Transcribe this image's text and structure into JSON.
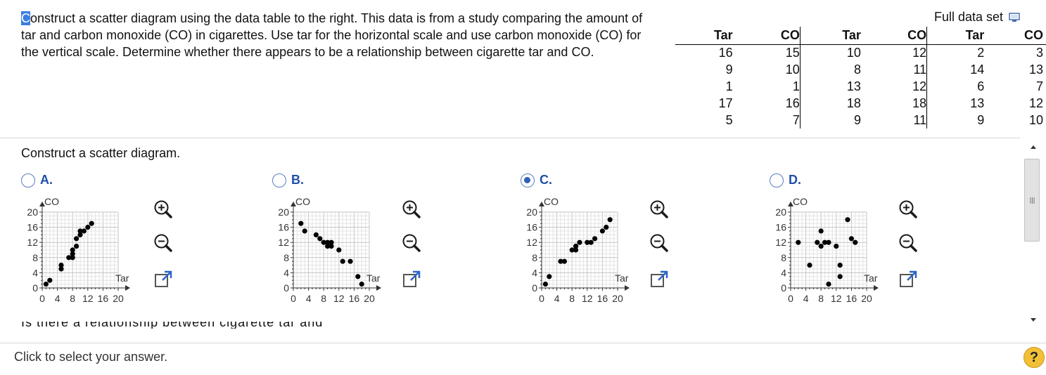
{
  "question": {
    "first_letter": "C",
    "text_rest": "onstruct a scatter diagram using the data table to the right. This data is from a study comparing the amount of tar and carbon monoxide (CO) in cigarettes. Use tar for the horizontal scale and use carbon monoxide (CO) for the vertical scale. Determine whether there appears to be a relationship between cigarette tar and CO."
  },
  "full_data_set": {
    "label": "Full data set",
    "icon": "print-icon"
  },
  "data_table": {
    "headers": [
      "Tar",
      "CO",
      "Tar",
      "CO",
      "Tar",
      "CO"
    ],
    "rows": [
      [
        "16",
        "15",
        "10",
        "12",
        "2",
        "3"
      ],
      [
        "9",
        "10",
        "8",
        "11",
        "14",
        "13"
      ],
      [
        "1",
        "1",
        "13",
        "12",
        "6",
        "7"
      ],
      [
        "17",
        "16",
        "18",
        "18",
        "13",
        "12"
      ],
      [
        "5",
        "7",
        "9",
        "11",
        "9",
        "10"
      ]
    ]
  },
  "subprompt": "Construct a scatter diagram.",
  "axes": {
    "y_label": "CO",
    "x_label": "Tar",
    "y_ticks": [
      "20",
      "16",
      "12",
      "8",
      "4",
      "0"
    ],
    "x_ticks": [
      "0",
      "4",
      "8",
      "12",
      "16",
      "20"
    ]
  },
  "options": [
    {
      "letter": "A.",
      "selected": false,
      "chart_data": {
        "type": "scatter",
        "xlabel": "Tar",
        "ylabel": "CO",
        "xlim": [
          0,
          20
        ],
        "ylim": [
          0,
          20
        ],
        "points": [
          [
            1,
            1
          ],
          [
            2,
            2
          ],
          [
            5,
            5
          ],
          [
            5,
            6
          ],
          [
            7,
            8
          ],
          [
            8,
            8
          ],
          [
            8,
            9
          ],
          [
            8,
            10
          ],
          [
            9,
            11
          ],
          [
            9,
            13
          ],
          [
            10,
            14
          ],
          [
            10,
            15
          ],
          [
            11,
            15
          ],
          [
            12,
            16
          ],
          [
            13,
            17
          ]
        ]
      }
    },
    {
      "letter": "B.",
      "selected": false,
      "chart_data": {
        "type": "scatter",
        "xlabel": "Tar",
        "ylabel": "CO",
        "xlim": [
          0,
          20
        ],
        "ylim": [
          0,
          20
        ],
        "points": [
          [
            2,
            17
          ],
          [
            3,
            15
          ],
          [
            6,
            14
          ],
          [
            7,
            13
          ],
          [
            8,
            12
          ],
          [
            9,
            12
          ],
          [
            9,
            11
          ],
          [
            10,
            12
          ],
          [
            10,
            11
          ],
          [
            12,
            10
          ],
          [
            13,
            7
          ],
          [
            15,
            7
          ],
          [
            17,
            3
          ],
          [
            18,
            1
          ]
        ]
      }
    },
    {
      "letter": "C.",
      "selected": true,
      "chart_data": {
        "type": "scatter",
        "xlabel": "Tar",
        "ylabel": "CO",
        "xlim": [
          0,
          20
        ],
        "ylim": [
          0,
          20
        ],
        "points": [
          [
            1,
            1
          ],
          [
            2,
            3
          ],
          [
            5,
            7
          ],
          [
            6,
            7
          ],
          [
            8,
            10
          ],
          [
            9,
            10
          ],
          [
            9,
            11
          ],
          [
            10,
            12
          ],
          [
            9,
            11
          ],
          [
            12,
            12
          ],
          [
            13,
            12
          ],
          [
            14,
            13
          ],
          [
            16,
            15
          ],
          [
            17,
            16
          ],
          [
            18,
            18
          ]
        ]
      }
    },
    {
      "letter": "D.",
      "selected": false,
      "chart_data": {
        "type": "scatter",
        "xlabel": "Tar",
        "ylabel": "CO",
        "xlim": [
          0,
          20
        ],
        "ylim": [
          0,
          20
        ],
        "points": [
          [
            2,
            12
          ],
          [
            5,
            6
          ],
          [
            7,
            12
          ],
          [
            8,
            15
          ],
          [
            8,
            11
          ],
          [
            9,
            12
          ],
          [
            10,
            12
          ],
          [
            10,
            1
          ],
          [
            12,
            11
          ],
          [
            13,
            6
          ],
          [
            13,
            3
          ],
          [
            15,
            18
          ],
          [
            16,
            13
          ],
          [
            17,
            12
          ]
        ]
      }
    }
  ],
  "cut_off_text": "Is there a relationship between cigarette tar and CO?",
  "footer": {
    "instruction": "Click to select your answer.",
    "help_label": "?"
  }
}
